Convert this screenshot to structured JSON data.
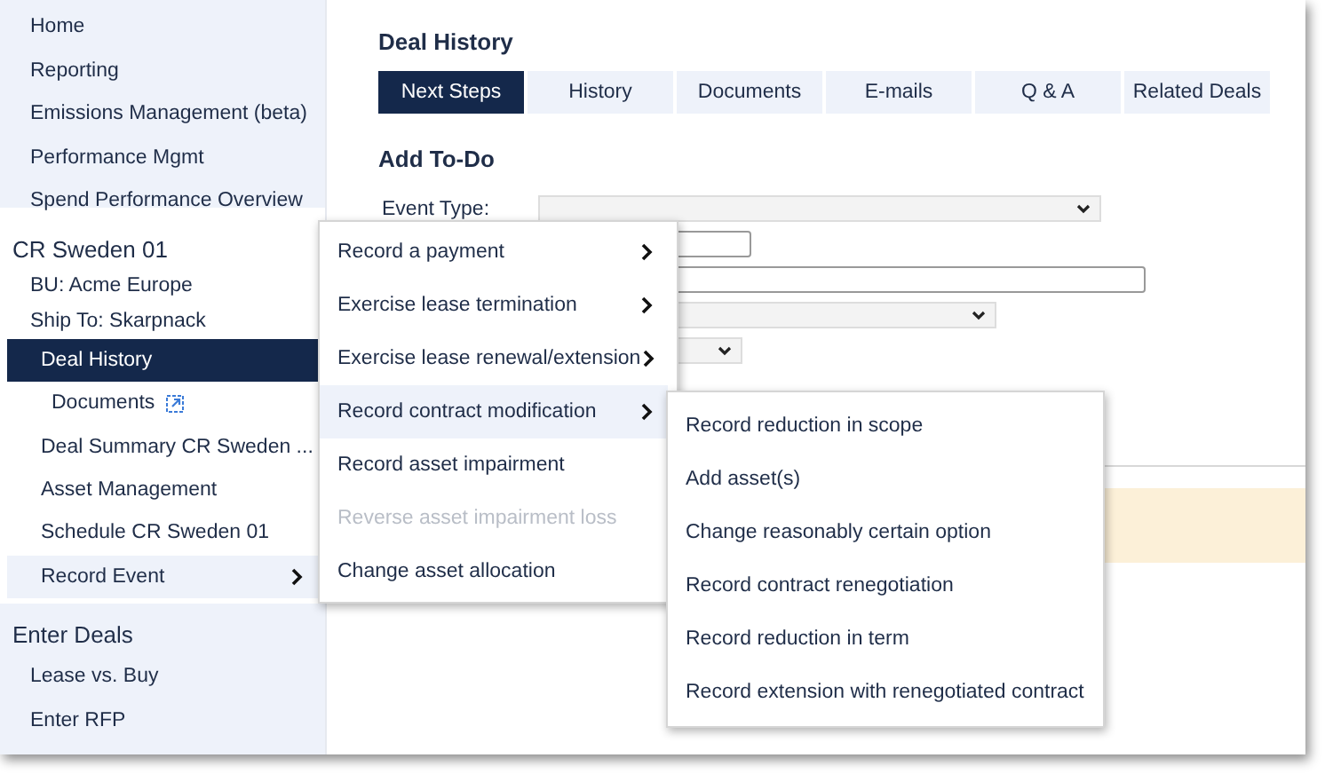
{
  "sidebar": {
    "nav": [
      {
        "label": "Home"
      },
      {
        "label": "Reporting"
      },
      {
        "label": "Emissions Management (beta)"
      },
      {
        "label": "Performance Mgmt"
      },
      {
        "label": "Spend Performance Overview"
      }
    ],
    "deal": {
      "title": "CR Sweden 01",
      "info": [
        "BU: Acme Europe",
        "Ship To: Skarpnack"
      ],
      "items": [
        {
          "label": "Deal History",
          "selected": true,
          "submenu": false,
          "children": [
            {
              "label": "Documents",
              "selected": false,
              "external": true
            }
          ]
        },
        {
          "label": "Deal Summary CR Sweden ...",
          "selected": false,
          "submenu": false
        },
        {
          "label": "Asset Management",
          "selected": false,
          "submenu": false
        },
        {
          "label": "Schedule CR Sweden 01",
          "selected": false,
          "submenu": false
        },
        {
          "label": "Record Event",
          "selected": false,
          "submenu": true,
          "expanded": true
        }
      ]
    },
    "enter": {
      "title": "Enter Deals",
      "items": [
        {
          "label": "Lease vs. Buy"
        },
        {
          "label": "Enter RFP"
        }
      ]
    }
  },
  "main": {
    "title": "Deal History",
    "tabs": [
      {
        "label": "Next Steps",
        "selected": true
      },
      {
        "label": "History",
        "selected": false
      },
      {
        "label": "Documents",
        "selected": false
      },
      {
        "label": "E-mails",
        "selected": false
      },
      {
        "label": "Q & A",
        "selected": false
      },
      {
        "label": "Related Deals",
        "selected": false
      }
    ],
    "section_title": "Add To-Do",
    "form": {
      "label": "Event Type:",
      "fields": [
        {
          "kind": "select"
        },
        {
          "kind": "input"
        },
        {
          "kind": "input"
        },
        {
          "kind": "select"
        },
        {
          "kind": "select"
        }
      ]
    },
    "notice": {
      "kind": "warning"
    }
  },
  "context_menu": {
    "items": [
      {
        "label": "Record a payment",
        "submenu": true,
        "selected": false,
        "disabled": false
      },
      {
        "label": "Exercise lease termination",
        "submenu": true,
        "selected": false,
        "disabled": false
      },
      {
        "label": "Exercise lease renewal/extension",
        "submenu": true,
        "selected": false,
        "disabled": false
      },
      {
        "label": "Record contract modification",
        "submenu": true,
        "selected": true,
        "disabled": false
      },
      {
        "label": "Record asset impairment",
        "submenu": false,
        "selected": false,
        "disabled": false
      },
      {
        "label": "Reverse asset impairment loss",
        "submenu": false,
        "selected": false,
        "disabled": true
      },
      {
        "label": "Change asset allocation",
        "submenu": false,
        "selected": false,
        "disabled": false
      }
    ]
  },
  "submenu": {
    "items": [
      {
        "label": "Record reduction in scope"
      },
      {
        "label": "Add asset(s)"
      },
      {
        "label": "Change reasonably certain option"
      },
      {
        "label": "Record contract renegotiation"
      },
      {
        "label": "Record reduction in term"
      },
      {
        "label": "Record extension with renegotiated contract"
      }
    ]
  }
}
